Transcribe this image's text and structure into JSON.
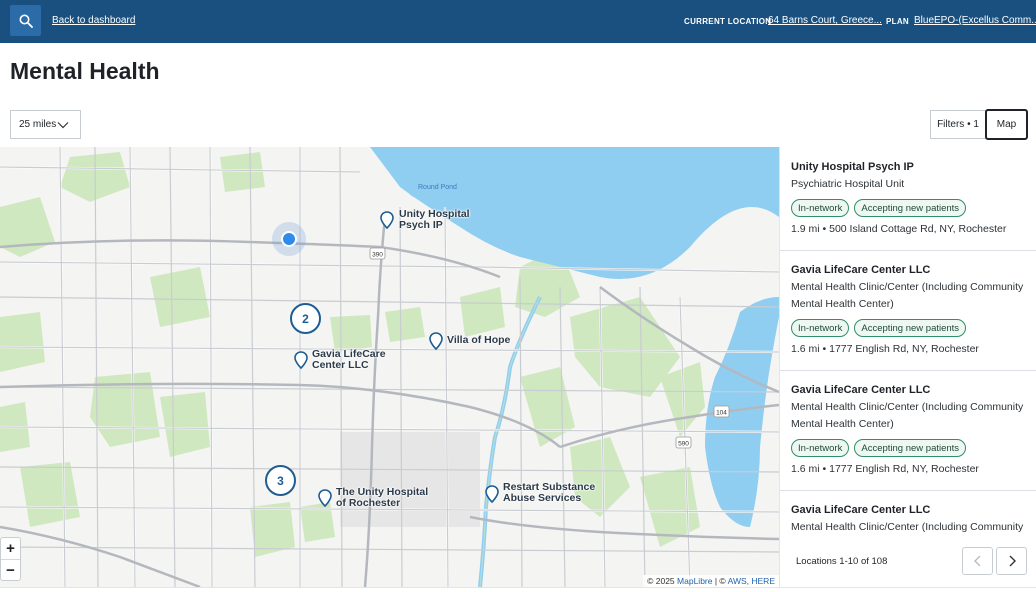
{
  "topbar": {
    "back_label": "Back to dashboard",
    "location_label": "CURRENT LOCATION",
    "location_value": "64 Barns Court, Greece...",
    "plan_label": "PLAN",
    "plan_value": "BlueEPO-(Excellus Comm..."
  },
  "page": {
    "title": "Mental Health"
  },
  "controls": {
    "distance": "25 miles",
    "filters_label": "Filters • 1",
    "map_label": "Map"
  },
  "map": {
    "user_location_color": "#2f8bea",
    "water_label": "Round\nPond",
    "road_labels": [
      "390",
      "104",
      "590"
    ],
    "clusters": [
      {
        "count": "2"
      },
      {
        "count": "3"
      }
    ],
    "markers": [
      {
        "label": "Unity Hospital\nPsych IP"
      },
      {
        "label": "Villa of Hope"
      },
      {
        "label": "Gavia LifeCare\nCenter LLC"
      },
      {
        "label": "The Unity Hospital\nof Rochester"
      },
      {
        "label": "Restart Substance\nAbuse Services"
      }
    ],
    "zoom_in": "+",
    "zoom_out": "−",
    "attribution_prefix": "© 2025",
    "attribution_maplibre": "MapLibre",
    "attribution_sep": "| ©",
    "attribution_aws": "AWS, HERE"
  },
  "results": [
    {
      "name": "Unity Hospital Psych IP",
      "type": "Psychiatric Hospital Unit",
      "badges": [
        "In-network",
        "Accepting new patients"
      ],
      "address": "1.9 mi • 500 Island Cottage Rd, NY, Rochester"
    },
    {
      "name": "Gavia LifeCare Center LLC",
      "type": "Mental Health Clinic/Center (Including Community Mental Health Center)",
      "badges": [
        "In-network",
        "Accepting new patients"
      ],
      "address": "1.6 mi • 1777 English Rd, NY, Rochester"
    },
    {
      "name": "Gavia LifeCare Center LLC",
      "type": "Mental Health Clinic/Center (Including Community Mental Health Center)",
      "badges": [
        "In-network",
        "Accepting new patients"
      ],
      "address": "1.6 mi • 1777 English Rd, NY, Rochester"
    },
    {
      "name": "Gavia LifeCare Center LLC",
      "type": "Mental Health Clinic/Center (Including Community",
      "badges": [],
      "address": ""
    }
  ],
  "pager": {
    "count_label": "Locations 1-10 of 108"
  },
  "colors": {
    "topbar": "#19507f",
    "accent": "#1e5d93",
    "badge_border": "#2f8f68",
    "water": "#90cef1",
    "park": "#cfe8c0"
  }
}
